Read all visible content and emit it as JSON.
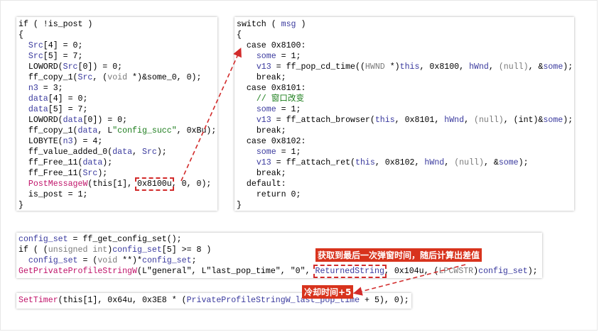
{
  "colors": {
    "keyword": "#000000",
    "variable": "#3a3a9e",
    "type": "#7a7a7a",
    "function_api": "#c0136a",
    "string": "#1d7d1d",
    "annotation": "#d8331d",
    "arrow": "#d22b2b"
  },
  "left_code": [
    [
      {
        "t": "if ( !is_post )",
        "c": "p"
      }
    ],
    [
      {
        "t": "{",
        "c": "p"
      }
    ],
    [
      {
        "t": "  ",
        "c": "p"
      },
      {
        "t": "Src",
        "c": "v"
      },
      {
        "t": "[4] = 0;",
        "c": "p"
      }
    ],
    [
      {
        "t": "  ",
        "c": "p"
      },
      {
        "t": "Src",
        "c": "v"
      },
      {
        "t": "[5] = 7;",
        "c": "p"
      }
    ],
    [
      {
        "t": "  LOWORD(",
        "c": "p"
      },
      {
        "t": "Src",
        "c": "v"
      },
      {
        "t": "[0]) = 0;",
        "c": "p"
      }
    ],
    [
      {
        "t": "  ff_copy_1(",
        "c": "p"
      },
      {
        "t": "Src",
        "c": "v"
      },
      {
        "t": ", (",
        "c": "p"
      },
      {
        "t": "void",
        "c": "t"
      },
      {
        "t": " *)&some_0, 0);",
        "c": "p"
      }
    ],
    [
      {
        "t": "  ",
        "c": "p"
      },
      {
        "t": "n3",
        "c": "v"
      },
      {
        "t": " = 3;",
        "c": "p"
      }
    ],
    [
      {
        "t": "  ",
        "c": "p"
      },
      {
        "t": "data",
        "c": "v"
      },
      {
        "t": "[4] = 0;",
        "c": "p"
      }
    ],
    [
      {
        "t": "  ",
        "c": "p"
      },
      {
        "t": "data",
        "c": "v"
      },
      {
        "t": "[5] = 7;",
        "c": "p"
      }
    ],
    [
      {
        "t": "  LOWORD(",
        "c": "p"
      },
      {
        "t": "data",
        "c": "v"
      },
      {
        "t": "[0]) = 0;",
        "c": "p"
      }
    ],
    [
      {
        "t": "  ff_copy_1(",
        "c": "p"
      },
      {
        "t": "data",
        "c": "v"
      },
      {
        "t": ", L",
        "c": "p"
      },
      {
        "t": "\"config_succ\"",
        "c": "s"
      },
      {
        "t": ", 0xBu);",
        "c": "p"
      }
    ],
    [
      {
        "t": "  LOBYTE(",
        "c": "p"
      },
      {
        "t": "n3",
        "c": "v"
      },
      {
        "t": ") = 4;",
        "c": "p"
      }
    ],
    [
      {
        "t": "  ff_value_added_0(",
        "c": "p"
      },
      {
        "t": "data",
        "c": "v"
      },
      {
        "t": ", ",
        "c": "p"
      },
      {
        "t": "Src",
        "c": "v"
      },
      {
        "t": ");",
        "c": "p"
      }
    ],
    [
      {
        "t": "  ff_Free_11(",
        "c": "p"
      },
      {
        "t": "data",
        "c": "v"
      },
      {
        "t": ");",
        "c": "p"
      }
    ],
    [
      {
        "t": "  ff_Free_11(",
        "c": "p"
      },
      {
        "t": "Src",
        "c": "v"
      },
      {
        "t": ");",
        "c": "p"
      }
    ],
    [
      {
        "t": "  ",
        "c": "p"
      },
      {
        "t": "PostMessageW",
        "c": "f"
      },
      {
        "t": "(this[1], ",
        "c": "p"
      },
      {
        "t": "0x8100u",
        "c": "p",
        "box": true
      },
      {
        "t": ", 0, 0);",
        "c": "p"
      }
    ],
    [
      {
        "t": "  is_post = 1;",
        "c": "p"
      }
    ],
    [
      {
        "t": "}",
        "c": "p"
      }
    ]
  ],
  "right_code": [
    [
      {
        "t": "switch ( ",
        "c": "p"
      },
      {
        "t": "msg",
        "c": "v"
      },
      {
        "t": " )",
        "c": "p"
      }
    ],
    [
      {
        "t": "{",
        "c": "p"
      }
    ],
    [
      {
        "t": "  case 0x8100:",
        "c": "p"
      }
    ],
    [
      {
        "t": "    ",
        "c": "p"
      },
      {
        "t": "some",
        "c": "v"
      },
      {
        "t": " = 1;",
        "c": "p"
      }
    ],
    [
      {
        "t": "    ",
        "c": "p"
      },
      {
        "t": "v13",
        "c": "v"
      },
      {
        "t": " = ff_pop_cd_time((",
        "c": "p"
      },
      {
        "t": "HWND",
        "c": "t"
      },
      {
        "t": " *)",
        "c": "p"
      },
      {
        "t": "this",
        "c": "v"
      },
      {
        "t": ", 0x8100, ",
        "c": "p"
      },
      {
        "t": "hWnd",
        "c": "v"
      },
      {
        "t": ", ",
        "c": "p"
      },
      {
        "t": "(null)",
        "c": "t"
      },
      {
        "t": ", &",
        "c": "p"
      },
      {
        "t": "some",
        "c": "v"
      },
      {
        "t": ");",
        "c": "p"
      }
    ],
    [
      {
        "t": "    break;",
        "c": "p"
      }
    ],
    [
      {
        "t": "  case 0x8101:",
        "c": "p"
      }
    ],
    [
      {
        "t": "    // 窗口改变",
        "c": "c"
      }
    ],
    [
      {
        "t": "    ",
        "c": "p"
      },
      {
        "t": "some",
        "c": "v"
      },
      {
        "t": " = 1;",
        "c": "p"
      }
    ],
    [
      {
        "t": "    ",
        "c": "p"
      },
      {
        "t": "v13",
        "c": "v"
      },
      {
        "t": " = ff_attach_browser(",
        "c": "p"
      },
      {
        "t": "this",
        "c": "v"
      },
      {
        "t": ", 0x8101, ",
        "c": "p"
      },
      {
        "t": "hWnd",
        "c": "v"
      },
      {
        "t": ", ",
        "c": "p"
      },
      {
        "t": "(null)",
        "c": "t"
      },
      {
        "t": ", (int)&",
        "c": "p"
      },
      {
        "t": "some",
        "c": "v"
      },
      {
        "t": ");",
        "c": "p"
      }
    ],
    [
      {
        "t": "    break;",
        "c": "p"
      }
    ],
    [
      {
        "t": "  case 0x8102:",
        "c": "p"
      }
    ],
    [
      {
        "t": "    ",
        "c": "p"
      },
      {
        "t": "some",
        "c": "v"
      },
      {
        "t": " = 1;",
        "c": "p"
      }
    ],
    [
      {
        "t": "    ",
        "c": "p"
      },
      {
        "t": "v13",
        "c": "v"
      },
      {
        "t": " = ff_attach_ret(",
        "c": "p"
      },
      {
        "t": "this",
        "c": "v"
      },
      {
        "t": ", 0x8102, ",
        "c": "p"
      },
      {
        "t": "hWnd",
        "c": "v"
      },
      {
        "t": ", ",
        "c": "p"
      },
      {
        "t": "(null)",
        "c": "t"
      },
      {
        "t": ", &",
        "c": "p"
      },
      {
        "t": "some",
        "c": "v"
      },
      {
        "t": ");",
        "c": "p"
      }
    ],
    [
      {
        "t": "    break;",
        "c": "p"
      }
    ],
    [
      {
        "t": "  default:",
        "c": "p"
      }
    ],
    [
      {
        "t": "    return 0;",
        "c": "p"
      }
    ],
    [
      {
        "t": "}",
        "c": "p"
      }
    ]
  ],
  "config_code": [
    [
      {
        "t": "config_set",
        "c": "v"
      },
      {
        "t": " = ff_get_config_set();",
        "c": "p"
      }
    ],
    [
      {
        "t": "if ( (",
        "c": "p"
      },
      {
        "t": "unsigned int",
        "c": "t"
      },
      {
        "t": ")",
        "c": "p"
      },
      {
        "t": "config_set",
        "c": "v"
      },
      {
        "t": "[5] >= 8 )",
        "c": "p"
      }
    ],
    [
      {
        "t": "  ",
        "c": "p"
      },
      {
        "t": "config_set",
        "c": "v"
      },
      {
        "t": " = (",
        "c": "p"
      },
      {
        "t": "void",
        "c": "t"
      },
      {
        "t": " **)*",
        "c": "p"
      },
      {
        "t": "config_set",
        "c": "v"
      },
      {
        "t": ";",
        "c": "p"
      }
    ],
    [
      {
        "t": "GetPrivateProfileStringW",
        "c": "f"
      },
      {
        "t": "(L",
        "c": "p"
      },
      {
        "t": "\"general\"",
        "c": "p"
      },
      {
        "t": ", L",
        "c": "p"
      },
      {
        "t": "\"last_pop_time\"",
        "c": "p"
      },
      {
        "t": ", ",
        "c": "p"
      },
      {
        "t": "\"0\"",
        "c": "p"
      },
      {
        "t": ", ",
        "c": "p"
      },
      {
        "t": "ReturnedString",
        "c": "v",
        "box": true
      },
      {
        "t": ", 0x104u, (",
        "c": "p"
      },
      {
        "t": "LPCWSTR",
        "c": "t"
      },
      {
        "t": ")",
        "c": "p"
      },
      {
        "t": "config_set",
        "c": "v"
      },
      {
        "t": ");",
        "c": "p"
      }
    ]
  ],
  "timer_code": [
    [
      {
        "t": "SetTimer",
        "c": "f"
      },
      {
        "t": "(this[1], 0x64u, 0x3E8 * (",
        "c": "p"
      },
      {
        "t": "PrivateProfileStringW_last_pop_time",
        "c": "v"
      },
      {
        "t": " + 5), 0);",
        "c": "p"
      }
    ]
  ],
  "annotations": {
    "pop_time_note": "获取到最后一次弹窗时间，随后计算出差值",
    "cooldown_note": "冷却时间+5"
  }
}
